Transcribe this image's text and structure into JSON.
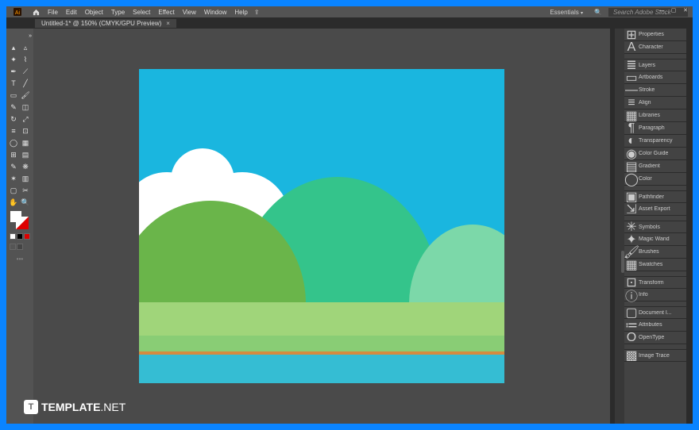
{
  "menu": {
    "items": [
      "File",
      "Edit",
      "Object",
      "Type",
      "Select",
      "Effect",
      "View",
      "Window",
      "Help"
    ],
    "workspace": "Essentials",
    "search_placeholder": "Search Adobe Stock"
  },
  "tab": {
    "label": "Untitled-1* @ 150% (CMYK/GPU Preview)"
  },
  "tools": {
    "names": [
      "selection",
      "direct-selection",
      "magic-wand",
      "lasso",
      "pen",
      "curvature",
      "type",
      "line",
      "rectangle",
      "paintbrush",
      "shaper",
      "eraser",
      "rotate",
      "scale",
      "width",
      "free-transform",
      "shape-builder",
      "perspective",
      "mesh",
      "gradient",
      "eyedropper",
      "blend",
      "symbol-sprayer",
      "column-graph",
      "artboard",
      "slice",
      "hand",
      "zoom"
    ]
  },
  "panels": {
    "items": [
      {
        "icon": "props",
        "label": "Properties"
      },
      {
        "icon": "char",
        "label": "Character"
      },
      {
        "icon": "layers",
        "label": "Layers",
        "gap": true
      },
      {
        "icon": "artboards",
        "label": "Artboards"
      },
      {
        "icon": "stroke",
        "label": "Stroke"
      },
      {
        "icon": "align",
        "label": "Align"
      },
      {
        "icon": "lib",
        "label": "Libraries"
      },
      {
        "icon": "para",
        "label": "Paragraph"
      },
      {
        "icon": "trans",
        "label": "Transparency"
      },
      {
        "icon": "cguide",
        "label": "Color Guide"
      },
      {
        "icon": "grad",
        "label": "Gradient"
      },
      {
        "icon": "color",
        "label": "Color"
      },
      {
        "icon": "path",
        "label": "Pathfinder",
        "gap": true
      },
      {
        "icon": "asset",
        "label": "Asset Export"
      },
      {
        "icon": "sym",
        "label": "Symbols",
        "gap": true
      },
      {
        "icon": "wand",
        "label": "Magic Wand"
      },
      {
        "icon": "brush",
        "label": "Brushes"
      },
      {
        "icon": "swatch",
        "label": "Swatches"
      },
      {
        "icon": "xform",
        "label": "Transform",
        "gap": true
      },
      {
        "icon": "info",
        "label": "Info"
      },
      {
        "icon": "doc",
        "label": "Document I...",
        "gap": true
      },
      {
        "icon": "attr",
        "label": "Attributes"
      },
      {
        "icon": "otype",
        "label": "OpenType"
      },
      {
        "icon": "trace",
        "label": "Image Trace",
        "gap": true
      }
    ]
  },
  "watermark": {
    "logo": "T",
    "name": "TEMPLATE",
    "suffix": ".NET"
  }
}
